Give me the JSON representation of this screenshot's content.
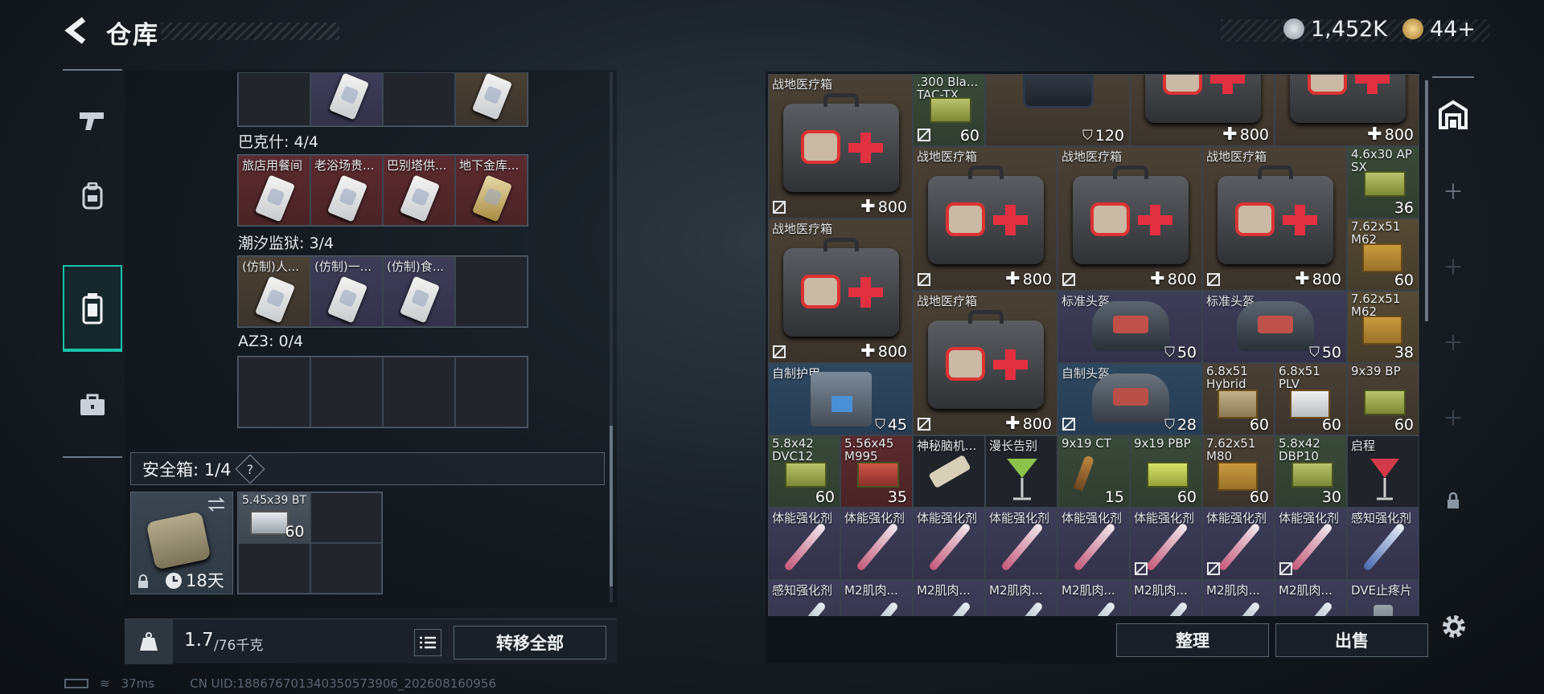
{
  "title": "仓库",
  "currency": {
    "money": "1,452K",
    "tokens": "44+"
  },
  "left": {
    "sections": [
      {
        "label": "巴克什: 4/4",
        "items": [
          "旅店用餐间",
          "老浴场贵...",
          "巴别塔供...",
          "地下金库..."
        ]
      },
      {
        "label": "潮汐监狱: 3/4",
        "items": [
          "(仿制)人...",
          "(仿制)一...",
          "(仿制)食...",
          ""
        ]
      },
      {
        "label": "AZ3: 0/4",
        "items": [
          "",
          "",
          "",
          ""
        ]
      }
    ],
    "safe_box": {
      "label": "安全箱: 1/4",
      "help": "?",
      "days": "18天",
      "item_name": "5.45x39 BT",
      "item_count": "60"
    },
    "weight": {
      "current": "1.7",
      "max": "/76千克"
    },
    "transfer_all": "转移全部"
  },
  "right": {
    "items": [
      {
        "name": "战地医疗箱",
        "value": "800"
      },
      {
        "name": ".300 Bla... TAC-TX",
        "value": "60"
      },
      {
        "name": "",
        "value": "120"
      },
      {
        "name": "",
        "value": "800"
      },
      {
        "name": "",
        "value": "800"
      },
      {
        "name": "战地医疗箱",
        "value": "800"
      },
      {
        "name": "战地医疗箱",
        "value": "800"
      },
      {
        "name": "战地医疗箱",
        "value": "800"
      },
      {
        "name": "4.6x30 AP SX",
        "value": "36"
      },
      {
        "name": "战地医疗箱",
        "value": "800"
      },
      {
        "name": "7.62x51 M62",
        "value": "60"
      },
      {
        "name": "战地医疗箱",
        "value": "800"
      },
      {
        "name": "标准头盔",
        "value": "50"
      },
      {
        "name": "标准头盔",
        "value": "50"
      },
      {
        "name": "7.62x51 M62",
        "value": "38"
      },
      {
        "name": "自制护甲",
        "value": "45"
      },
      {
        "name": "自制头盔",
        "value": "28"
      },
      {
        "name": "6.8x51 Hybrid",
        "value": "60"
      },
      {
        "name": "6.8x51 PLV",
        "value": "60"
      },
      {
        "name": "9x39 BP",
        "value": "60"
      },
      {
        "name": "5.8x42 DVC12",
        "value": "60"
      },
      {
        "name": "5.56x45 M995",
        "value": "35"
      },
      {
        "name": "神秘脑机...",
        "value": ""
      },
      {
        "name": "漫长告别",
        "value": ""
      },
      {
        "name": "9x19 CT",
        "value": "15"
      },
      {
        "name": "9x19 PBP",
        "value": "60"
      },
      {
        "name": "7.62x51 M80",
        "value": "60"
      },
      {
        "name": "5.8x42 DBP10",
        "value": "30"
      },
      {
        "name": "启程",
        "value": ""
      },
      {
        "name": "体能强化剂",
        "value": ""
      },
      {
        "name": "感知强化剂",
        "value": ""
      },
      {
        "name": "感知强化剂",
        "value": ""
      },
      {
        "name": "M2肌肉...",
        "value": ""
      },
      {
        "name": "DVE止疼片",
        "value": ""
      }
    ],
    "sort_button": "整理",
    "sell_button": "出售"
  },
  "footer": {
    "ping": "37ms",
    "uid": "CN UID:18867670134035057390​6_202608160956"
  },
  "colors": {
    "accent": "#19c2a8",
    "item_red": "#5c2a2e",
    "item_purple": "#3e3d58"
  },
  "icons": [
    "back-arrow-icon",
    "silver-coin-icon",
    "gold-coin-icon",
    "pistol-icon",
    "backpack-icon",
    "container-icon",
    "briefcase-icon",
    "swap-icon",
    "lock-icon",
    "clock-icon",
    "weight-icon",
    "list-icon",
    "base-icon",
    "plus-icon",
    "gear-icon",
    "shield-icon",
    "cross-icon",
    "no-trade-icon"
  ]
}
